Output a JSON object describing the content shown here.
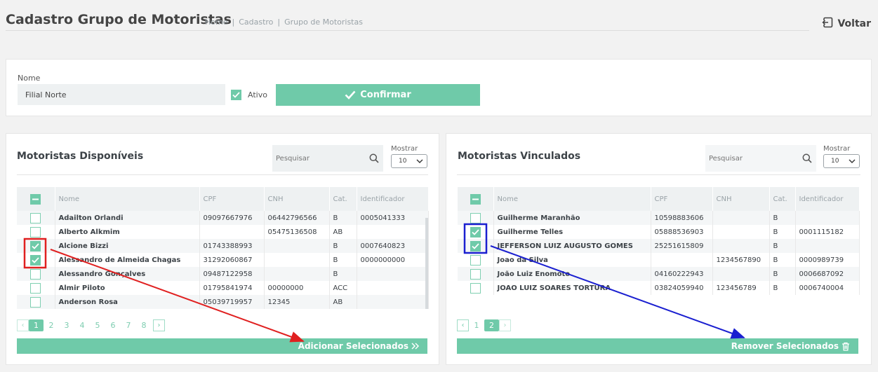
{
  "header": {
    "title": "Cadastro Grupo de Motoristas",
    "breadcrumb": [
      "Home",
      "Cadastro",
      "Grupo de Motoristas"
    ],
    "back_label": "Voltar"
  },
  "form": {
    "name_label": "Nome",
    "name_value": "Filial Norte",
    "active_label": "Ativo",
    "active_checked": true,
    "confirm_label": "Confirmar"
  },
  "available": {
    "title": "Motoristas Disponíveis",
    "search_placeholder": "Pesquisar",
    "show_label": "Mostrar",
    "show_value": "10",
    "columns": [
      "Nome",
      "CPF",
      "CNH",
      "Cat.",
      "Identificador"
    ],
    "rows": [
      {
        "nome": "Adailton Orlandi",
        "cpf": "09097667976",
        "cnh": "06442796566",
        "cat": "B",
        "id": "0005041333",
        "checked": false
      },
      {
        "nome": "Alberto Alkmim",
        "cpf": "",
        "cnh": "05475136508",
        "cat": "AB",
        "id": "",
        "checked": false
      },
      {
        "nome": "Alcione Bizzi",
        "cpf": "01743388993",
        "cnh": "",
        "cat": "B",
        "id": "0007640823",
        "checked": true
      },
      {
        "nome": "Alessandro de Almeida Chagas",
        "cpf": "31292060867",
        "cnh": "",
        "cat": "B",
        "id": "0000000000",
        "checked": true
      },
      {
        "nome": "Alessandro Gonçalves",
        "cpf": "09487122958",
        "cnh": "",
        "cat": "B",
        "id": "",
        "checked": false
      },
      {
        "nome": "Almir Piloto",
        "cpf": "01795841974",
        "cnh": "00000000",
        "cat": "ACC",
        "id": "",
        "checked": false
      },
      {
        "nome": "Anderson Rosa",
        "cpf": "05039719957",
        "cnh": "12345",
        "cat": "AB",
        "id": "",
        "checked": false
      }
    ],
    "pages": [
      "1",
      "2",
      "3",
      "4",
      "5",
      "6",
      "7",
      "8"
    ],
    "current_page": "1",
    "action_label": "Adicionar Selecionados"
  },
  "linked": {
    "title": "Motoristas Vinculados",
    "search_placeholder": "Pesquisar",
    "show_label": "Mostrar",
    "show_value": "10",
    "columns": [
      "Nome",
      "CPF",
      "CNH",
      "Cat.",
      "Identificador"
    ],
    "rows": [
      {
        "nome": "Guilherme Maranhão",
        "cpf": "10598883606",
        "cnh": "",
        "cat": "B",
        "id": "",
        "checked": false
      },
      {
        "nome": "Guilherme Telles",
        "cpf": "05888536903",
        "cnh": "",
        "cat": "B",
        "id": "0001115182",
        "checked": true
      },
      {
        "nome": "JEFFERSON LUIZ AUGUSTO GOMES",
        "cpf": "25251615809",
        "cnh": "",
        "cat": "B",
        "id": "",
        "checked": true
      },
      {
        "nome": "Joao da Silva",
        "cpf": "",
        "cnh": "1234567890",
        "cat": "B",
        "id": "0000989739",
        "checked": false
      },
      {
        "nome": "João Luiz Enomoto",
        "cpf": "04160222943",
        "cnh": "",
        "cat": "B",
        "id": "0006687092",
        "checked": false
      },
      {
        "nome": "JOAO LUIZ SOARES TORTURA",
        "cpf": "03824059940",
        "cnh": "123456789",
        "cat": "B",
        "id": "0006740004",
        "checked": false
      }
    ],
    "pages": [
      "1",
      "2"
    ],
    "current_page": "2",
    "action_label": "Remover Selecionados"
  },
  "colors": {
    "accent": "#6fcaa9",
    "annotation_red": "#e02020",
    "annotation_blue": "#1a1fd0"
  }
}
